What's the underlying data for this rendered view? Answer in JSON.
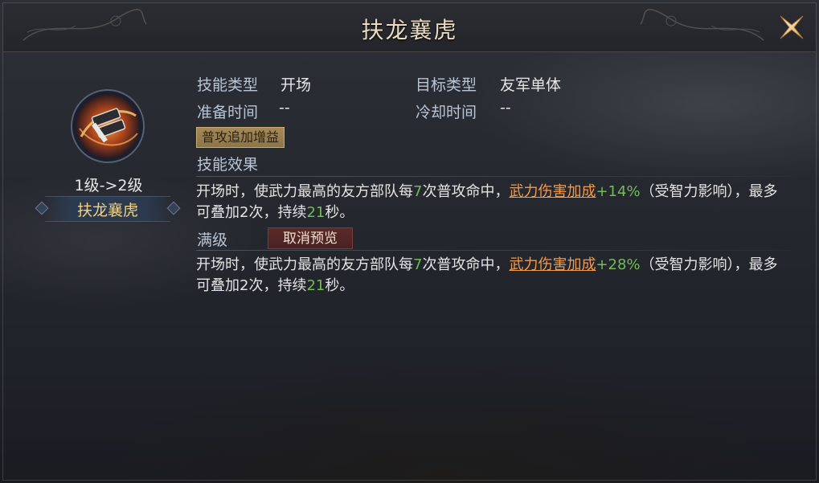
{
  "dialog": {
    "title": "扶龙襄虎"
  },
  "skill": {
    "icon": "crossed-blades-skill-icon",
    "level_text": "1级->2级",
    "name": "扶龙襄虎"
  },
  "info": {
    "skill_type_label": "技能类型",
    "skill_type_value": "开场",
    "target_type_label": "目标类型",
    "target_type_value": "友军单体",
    "prep_time_label": "准备时间",
    "prep_time_value": "--",
    "cooldown_label": "冷却时间",
    "cooldown_value": "--",
    "tag": "普攻追加增益",
    "effect_label": "技能效果"
  },
  "effect_current": {
    "part1": "开场时，使武力最高的友方部队每",
    "count": "7",
    "part2": "次普攻命中，",
    "link": "武力伤害加成",
    "bonus": "+14%",
    "part3": "（受智力影响）",
    "part4": "，最多可叠加2次，持续",
    "duration": "21",
    "part5": "秒。"
  },
  "max_level": {
    "label": "满级",
    "cancel_preview": "取消预览"
  },
  "effect_max": {
    "part1": "开场时，使武力最高的友方部队每",
    "count": "7",
    "part2": "次普攻命中，",
    "link": "武力伤害加成",
    "bonus": "+28%",
    "part3": "（受智力影响）",
    "part4": "，最多可叠加2次，持续",
    "duration": "21",
    "part5": "秒。"
  },
  "colors": {
    "title": "#e9dcc0",
    "label": "#b9c5d4",
    "skill_name": "#f3d184",
    "highlight_number": "#6fbd55",
    "highlight_link": "#f39a4a"
  }
}
